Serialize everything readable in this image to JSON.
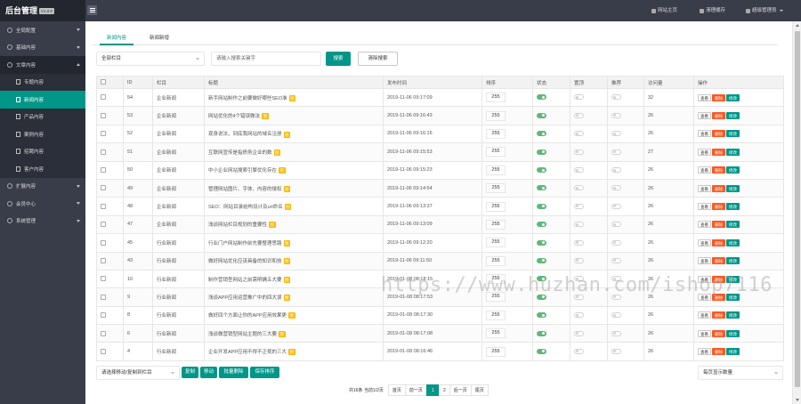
{
  "app": {
    "title": "后台管理",
    "version": "V1.0.0"
  },
  "sidebar": {
    "items": [
      {
        "label": "全局配置",
        "icon": "gear-icon"
      },
      {
        "label": "基础内容",
        "icon": "grid-icon"
      },
      {
        "label": "文章内容",
        "icon": "doc-icon"
      },
      {
        "label": "扩展内容",
        "icon": "puzzle-icon"
      },
      {
        "label": "会员中心",
        "icon": "user-icon"
      },
      {
        "label": "系统管理",
        "icon": "settings-icon"
      }
    ],
    "sub_items": [
      "专题内容",
      "新闻内容",
      "产品内容",
      "案例内容",
      "招聘内容",
      "客户内容"
    ]
  },
  "topbar": {
    "site_home": "网站主页",
    "clear_cache": "清理缓存",
    "admin": "超级管理员"
  },
  "tabs": [
    "新闻内容",
    "新闻新增"
  ],
  "filters": {
    "column_select": "全部栏目",
    "search_placeholder": "请输入搜索关键字",
    "search_btn": "搜索",
    "clear_btn": "清除搜索"
  },
  "table": {
    "headers": [
      "ID",
      "栏目",
      "标题",
      "发布时间",
      "排序",
      "状态",
      "置顶",
      "推荐",
      "访问量",
      "操作"
    ],
    "tag_label": "图",
    "actions": {
      "view": "查看",
      "delete": "删除",
      "edit": "修改"
    },
    "rows": [
      {
        "id": "54",
        "column": "企业新闻",
        "title": "新手网站制作之前要做好哪些SEO准",
        "date": "2019-11-06 09:17:09",
        "sort": "255",
        "status": true,
        "top": false,
        "rec": false,
        "visits": "32"
      },
      {
        "id": "53",
        "column": "企业新闻",
        "title": "网站优化的4个错误做法",
        "date": "2019-11-06 09:16:43",
        "sort": "255",
        "status": true,
        "top": false,
        "rec": false,
        "visits": "26"
      },
      {
        "id": "52",
        "column": "企业新闻",
        "title": "现身说法，到底我网站的域名注册",
        "date": "2019-11-06 09:16:16",
        "sort": "255",
        "status": true,
        "top": false,
        "rec": false,
        "visits": "26"
      },
      {
        "id": "51",
        "column": "企业新闻",
        "title": "互联网宣传是指债务企业的数",
        "date": "2019-11-06 09:15:53",
        "sort": "255",
        "status": true,
        "top": false,
        "rec": false,
        "visits": "27"
      },
      {
        "id": "50",
        "column": "企业新闻",
        "title": "中小企业网站搜索引擎优化存在",
        "date": "2019-11-06 09:15:23",
        "sort": "255",
        "status": true,
        "top": false,
        "rec": false,
        "visits": "26"
      },
      {
        "id": "49",
        "column": "企业新闻",
        "title": "管理网站图片、字体、内容的侵权",
        "date": "2019-11-06 09:14:54",
        "sort": "255",
        "status": true,
        "top": false,
        "rec": false,
        "visits": "26"
      },
      {
        "id": "48",
        "column": "企业新闻",
        "title": "SEO：网站目录结构设计及url命名",
        "date": "2019-11-06 09:13:37",
        "sort": "255",
        "status": true,
        "top": false,
        "rec": false,
        "visits": "26"
      },
      {
        "id": "47",
        "column": "企业新闻",
        "title": "浅谈网站栏目规划的重要性",
        "date": "2019-11-06 09:13:09",
        "sort": "255",
        "status": true,
        "top": false,
        "rec": false,
        "visits": "26"
      },
      {
        "id": "45",
        "column": "行业新闻",
        "title": "行业门户网站制作前先要整理思路",
        "date": "2019-11-06 09:12:20",
        "sort": "255",
        "status": true,
        "top": false,
        "rec": false,
        "visits": "26"
      },
      {
        "id": "43",
        "column": "行业新闻",
        "title": "做好网站优化应该具备的知识和技",
        "date": "2019-11-06 09:11:50",
        "sort": "255",
        "status": true,
        "top": false,
        "rec": false,
        "visits": "26"
      },
      {
        "id": "10",
        "column": "行业新闻",
        "title": "制作营销型网站之前需明确五大要",
        "date": "2019-01-08 08:18:15",
        "sort": "255",
        "status": true,
        "top": false,
        "rec": false,
        "visits": "26"
      },
      {
        "id": "9",
        "column": "行业新闻",
        "title": "浅谈APP应用运营推广中的四大误",
        "date": "2019-01-08 08:17:53",
        "sort": "255",
        "status": true,
        "top": false,
        "rec": false,
        "visits": "26"
      },
      {
        "id": "8",
        "column": "行业新闻",
        "title": "做好四个方面让你的APP应用效果更",
        "date": "2019-01-08 08:17:30",
        "sort": "255",
        "status": true,
        "top": false,
        "rec": false,
        "visits": "26"
      },
      {
        "id": "6",
        "column": "行业新闻",
        "title": "浅谈做营销型网站主题的三大要",
        "date": "2019-01-08 08:17:08",
        "sort": "255",
        "status": true,
        "top": false,
        "rec": false,
        "visits": "26"
      },
      {
        "id": "4",
        "column": "行业新闻",
        "title": "企业开发APP应用不得不正视的三大",
        "date": "2019-01-08 08:16:46",
        "sort": "255",
        "status": true,
        "top": false,
        "rec": false,
        "visits": "26"
      }
    ]
  },
  "bulk": {
    "select": "请选择移动/复制到栏目",
    "copy": "复制",
    "move": "移动",
    "batch_delete": "批量删除",
    "save_sort": "保存排序",
    "per_page": "每页显示数量"
  },
  "pager": {
    "info": "共16条 当前1/2页",
    "first": "首页",
    "prev": "前一页",
    "pages": [
      "1",
      "2"
    ],
    "current": "1",
    "next": "后一页",
    "last": "尾页"
  },
  "watermark": "https://www.huzhan.com/ishop7116",
  "colors": {
    "accent": "#009688",
    "danger": "#FF5722",
    "tag": "#FFB800",
    "sidebar": "#393D49",
    "switch_on": "#5FB878"
  }
}
